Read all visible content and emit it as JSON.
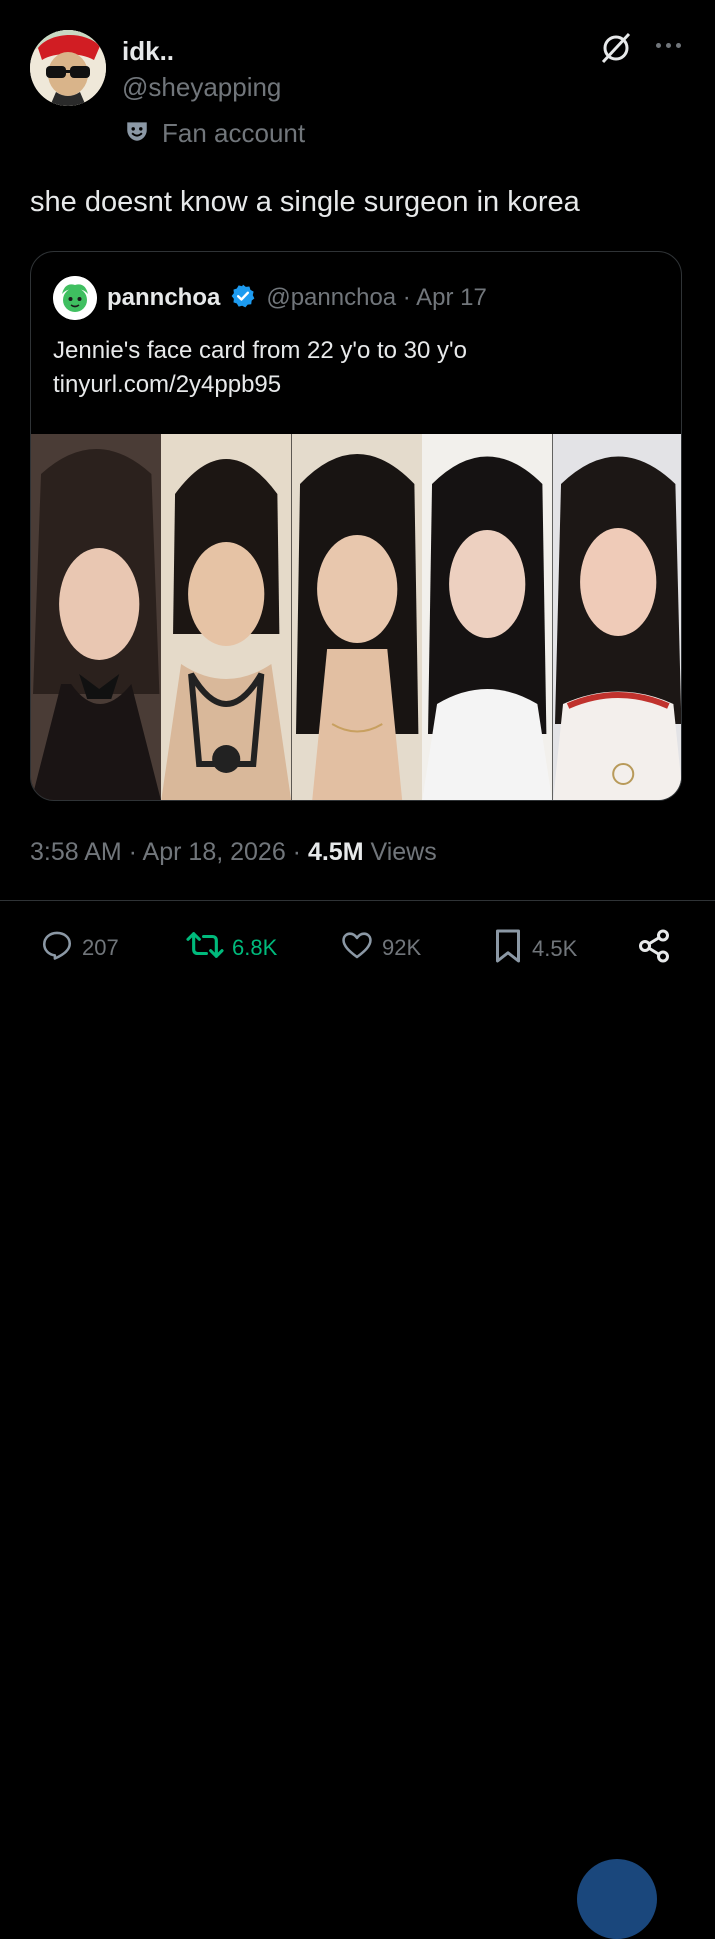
{
  "author": {
    "name": "idk..",
    "handle": "@sheyapping",
    "badge_icon": "theater-mask-icon",
    "badge_text": "Fan account"
  },
  "tweet": {
    "text": "she doesnt know a single surgeon in korea",
    "timestamp": "3:58 AM · Apr 18, 2026 · ",
    "views_count": "4.5M",
    "views_label": " Views"
  },
  "quote": {
    "name": "pannchoa",
    "verified": true,
    "handle_date": "@pannchoa · Apr 17",
    "text_line1": "Jennie's face card from 22 y'o to 30 y'o",
    "text_line2": "tinyurl.com/2y4ppb95",
    "photo_count": 5
  },
  "actions": {
    "replies": "207",
    "reposts": "6.8K",
    "likes": "92K",
    "bookmarks": "4.5K"
  },
  "colors": {
    "background": "#000000",
    "text": "#e7e9ea",
    "muted": "#71767b",
    "repost_green": "#00ba7c",
    "verified_blue": "#1d9bf0"
  }
}
